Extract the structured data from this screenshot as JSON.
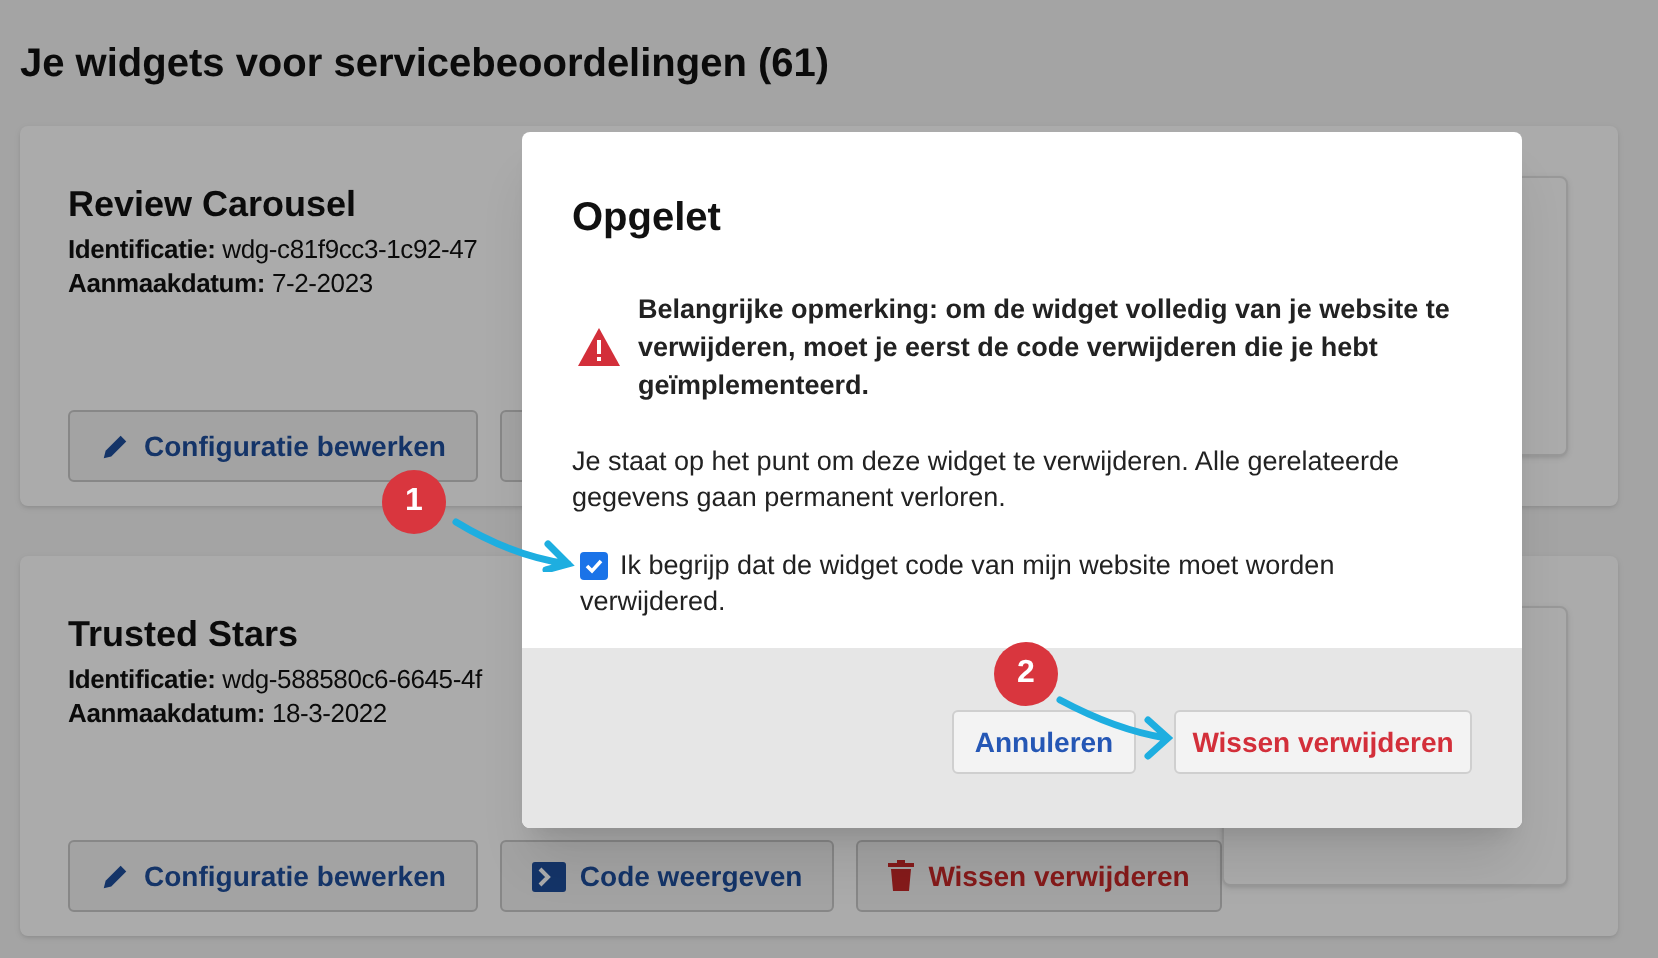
{
  "page": {
    "title": "Je widgets voor servicebeoordelingen (61)"
  },
  "widgets": [
    {
      "name": "Review Carousel",
      "id_label": "Identificatie:",
      "id_value": "wdg-c81f9cc3-1c92-47",
      "date_label": "Aanmaakdatum:",
      "date_value": "7-2-2023",
      "actions": [
        {
          "kind": "edit",
          "label": "Configuratie bewerken"
        },
        {
          "kind": "code"
        }
      ]
    },
    {
      "name": "Trusted Stars",
      "id_label": "Identificatie:",
      "id_value": "wdg-588580c6-6645-4f",
      "date_label": "Aanmaakdatum:",
      "date_value": "18-3-2022",
      "actions": [
        {
          "kind": "edit",
          "label": "Configuratie bewerken"
        },
        {
          "kind": "code",
          "label": "Code weergeven"
        },
        {
          "kind": "delete",
          "label": "Wissen verwijderen"
        }
      ]
    }
  ],
  "dialog": {
    "title": "Opgelet",
    "warning": "Belangrijke opmerking: om de widget volledig van je website te verwijderen, moet je eerst de code verwijderen die je hebt geïmplementeerd.",
    "message": "Je staat op het punt om deze widget te verwijderen. Alle gerelateerde gegevens gaan permanent verloren.",
    "confirm": {
      "label": "Ik begrijp dat de widget code van mijn website moet worden verwijdered.",
      "checked": true
    },
    "buttons": [
      {
        "kind": "cancel",
        "label": "Annuleren"
      },
      {
        "kind": "delete",
        "label": "Wissen verwijderen"
      }
    ]
  },
  "callouts": [
    {
      "number": "1"
    },
    {
      "number": "2"
    }
  ]
}
